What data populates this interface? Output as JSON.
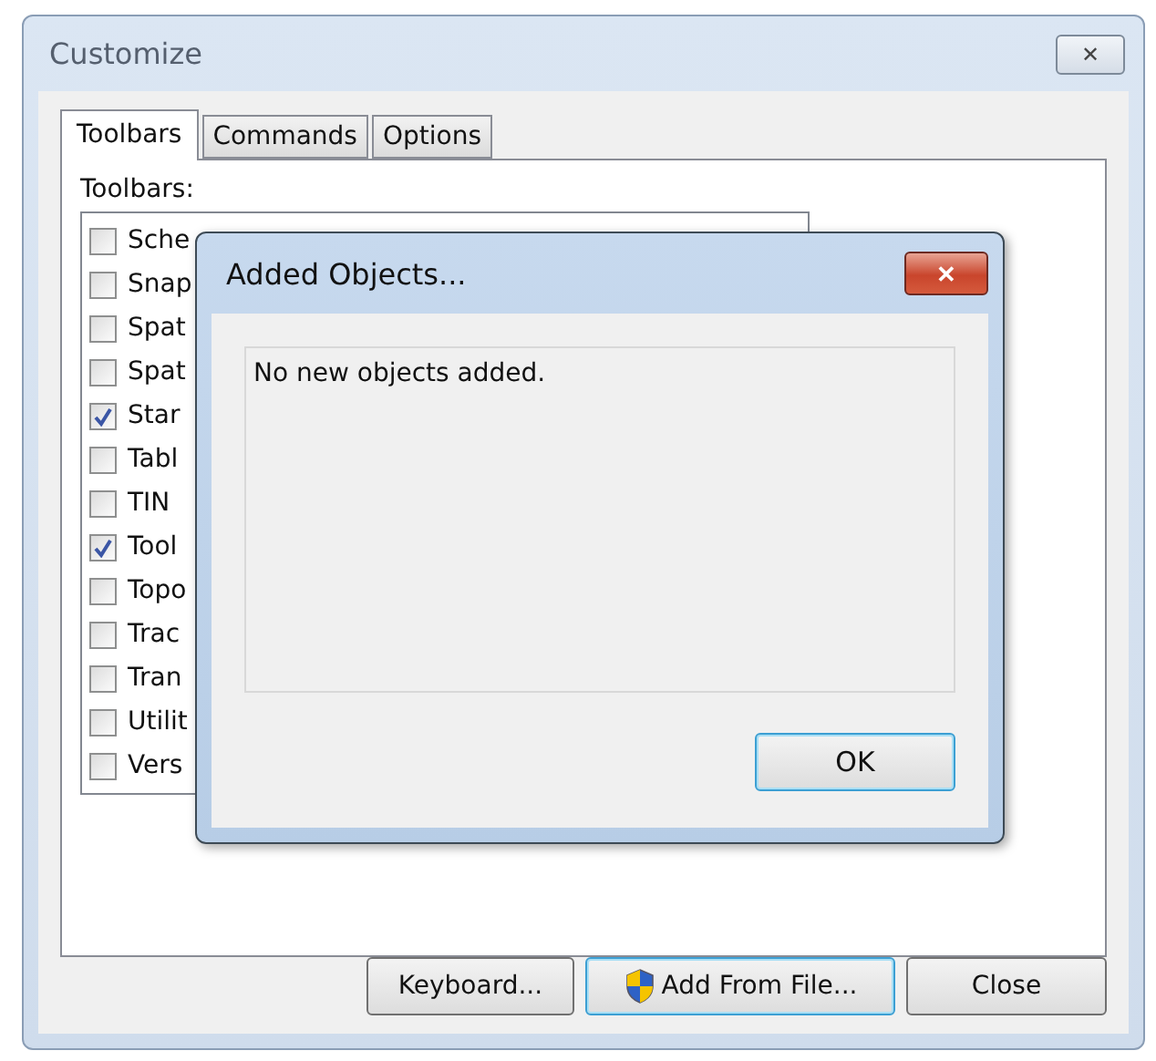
{
  "window": {
    "title": "Customize",
    "close": "✕"
  },
  "tabs": [
    {
      "label": "Toolbars",
      "selected": true
    },
    {
      "label": "Commands",
      "selected": false
    },
    {
      "label": "Options",
      "selected": false
    }
  ],
  "toolbars_label": "Toolbars:",
  "toolbars": [
    {
      "label": "Sche",
      "checked": false
    },
    {
      "label": "Snap",
      "checked": false
    },
    {
      "label": "Spat",
      "checked": false
    },
    {
      "label": "Spat",
      "checked": false
    },
    {
      "label": "Star",
      "checked": true
    },
    {
      "label": "Tabl",
      "checked": false
    },
    {
      "label": "TIN",
      "checked": false
    },
    {
      "label": "Tool",
      "checked": true
    },
    {
      "label": "Topo",
      "checked": false
    },
    {
      "label": "Trac",
      "checked": false
    },
    {
      "label": "Tran",
      "checked": false
    },
    {
      "label": "Utilit",
      "checked": false
    },
    {
      "label": "Vers",
      "checked": false
    }
  ],
  "buttons": [
    {
      "label": "Keyboard...",
      "shield": false,
      "focused": false
    },
    {
      "label": "Add From File...",
      "shield": true,
      "focused": true
    },
    {
      "label": "Close",
      "shield": false,
      "focused": false
    }
  ],
  "dialog": {
    "title": "Added Objects...",
    "close": "✕",
    "message": "No new objects added.",
    "ok": "OK"
  }
}
